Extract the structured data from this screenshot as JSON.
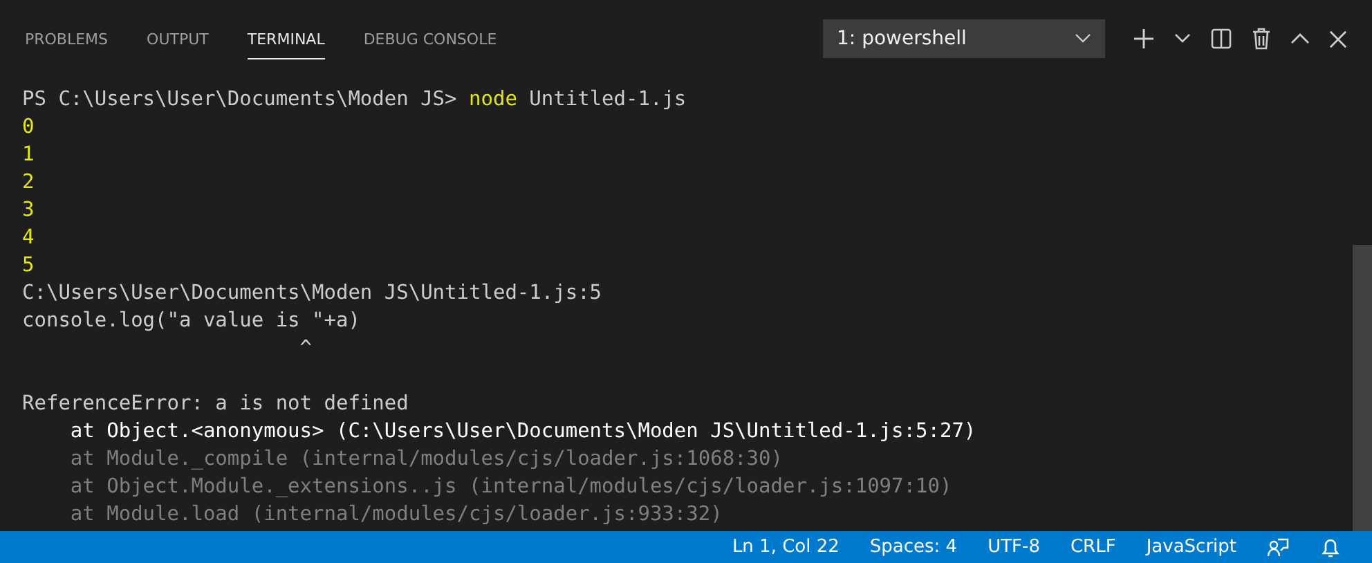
{
  "tabs": [
    {
      "label": "PROBLEMS",
      "selected": false
    },
    {
      "label": "OUTPUT",
      "selected": false
    },
    {
      "label": "TERMINAL",
      "selected": true
    },
    {
      "label": "DEBUG CONSOLE",
      "selected": false
    }
  ],
  "terminal_select": {
    "value": "1: powershell"
  },
  "terminal": [
    {
      "kind": "prompt",
      "prompt": "PS C:\\Users\\User\\Documents\\Moden JS>",
      "command": "node",
      "args": "Untitled-1.js"
    },
    {
      "kind": "output",
      "text": "0"
    },
    {
      "kind": "output",
      "text": "1"
    },
    {
      "kind": "output",
      "text": "2"
    },
    {
      "kind": "output",
      "text": "3"
    },
    {
      "kind": "output",
      "text": "4"
    },
    {
      "kind": "output",
      "text": "5"
    },
    {
      "kind": "text",
      "text": "C:\\Users\\User\\Documents\\Moden JS\\Untitled-1.js:5"
    },
    {
      "kind": "text",
      "text": "console.log(\"a value is \"+a)"
    },
    {
      "kind": "text",
      "text": "                       ^"
    },
    {
      "kind": "blank"
    },
    {
      "kind": "text",
      "text": "ReferenceError: a is not defined"
    },
    {
      "kind": "stack",
      "text": "    at Object.<anonymous> (C:\\Users\\User\\Documents\\Moden JS\\Untitled-1.js:5:27)"
    },
    {
      "kind": "dim",
      "text": "    at Module._compile (internal/modules/cjs/loader.js:1068:30)"
    },
    {
      "kind": "dim",
      "text": "    at Object.Module._extensions..js (internal/modules/cjs/loader.js:1097:10)"
    },
    {
      "kind": "dim",
      "text": "    at Module.load (internal/modules/cjs/loader.js:933:32)"
    }
  ],
  "status_bar": [
    "Ln 1, Col 22",
    "Spaces: 4",
    "UTF-8",
    "CRLF",
    "JavaScript"
  ]
}
